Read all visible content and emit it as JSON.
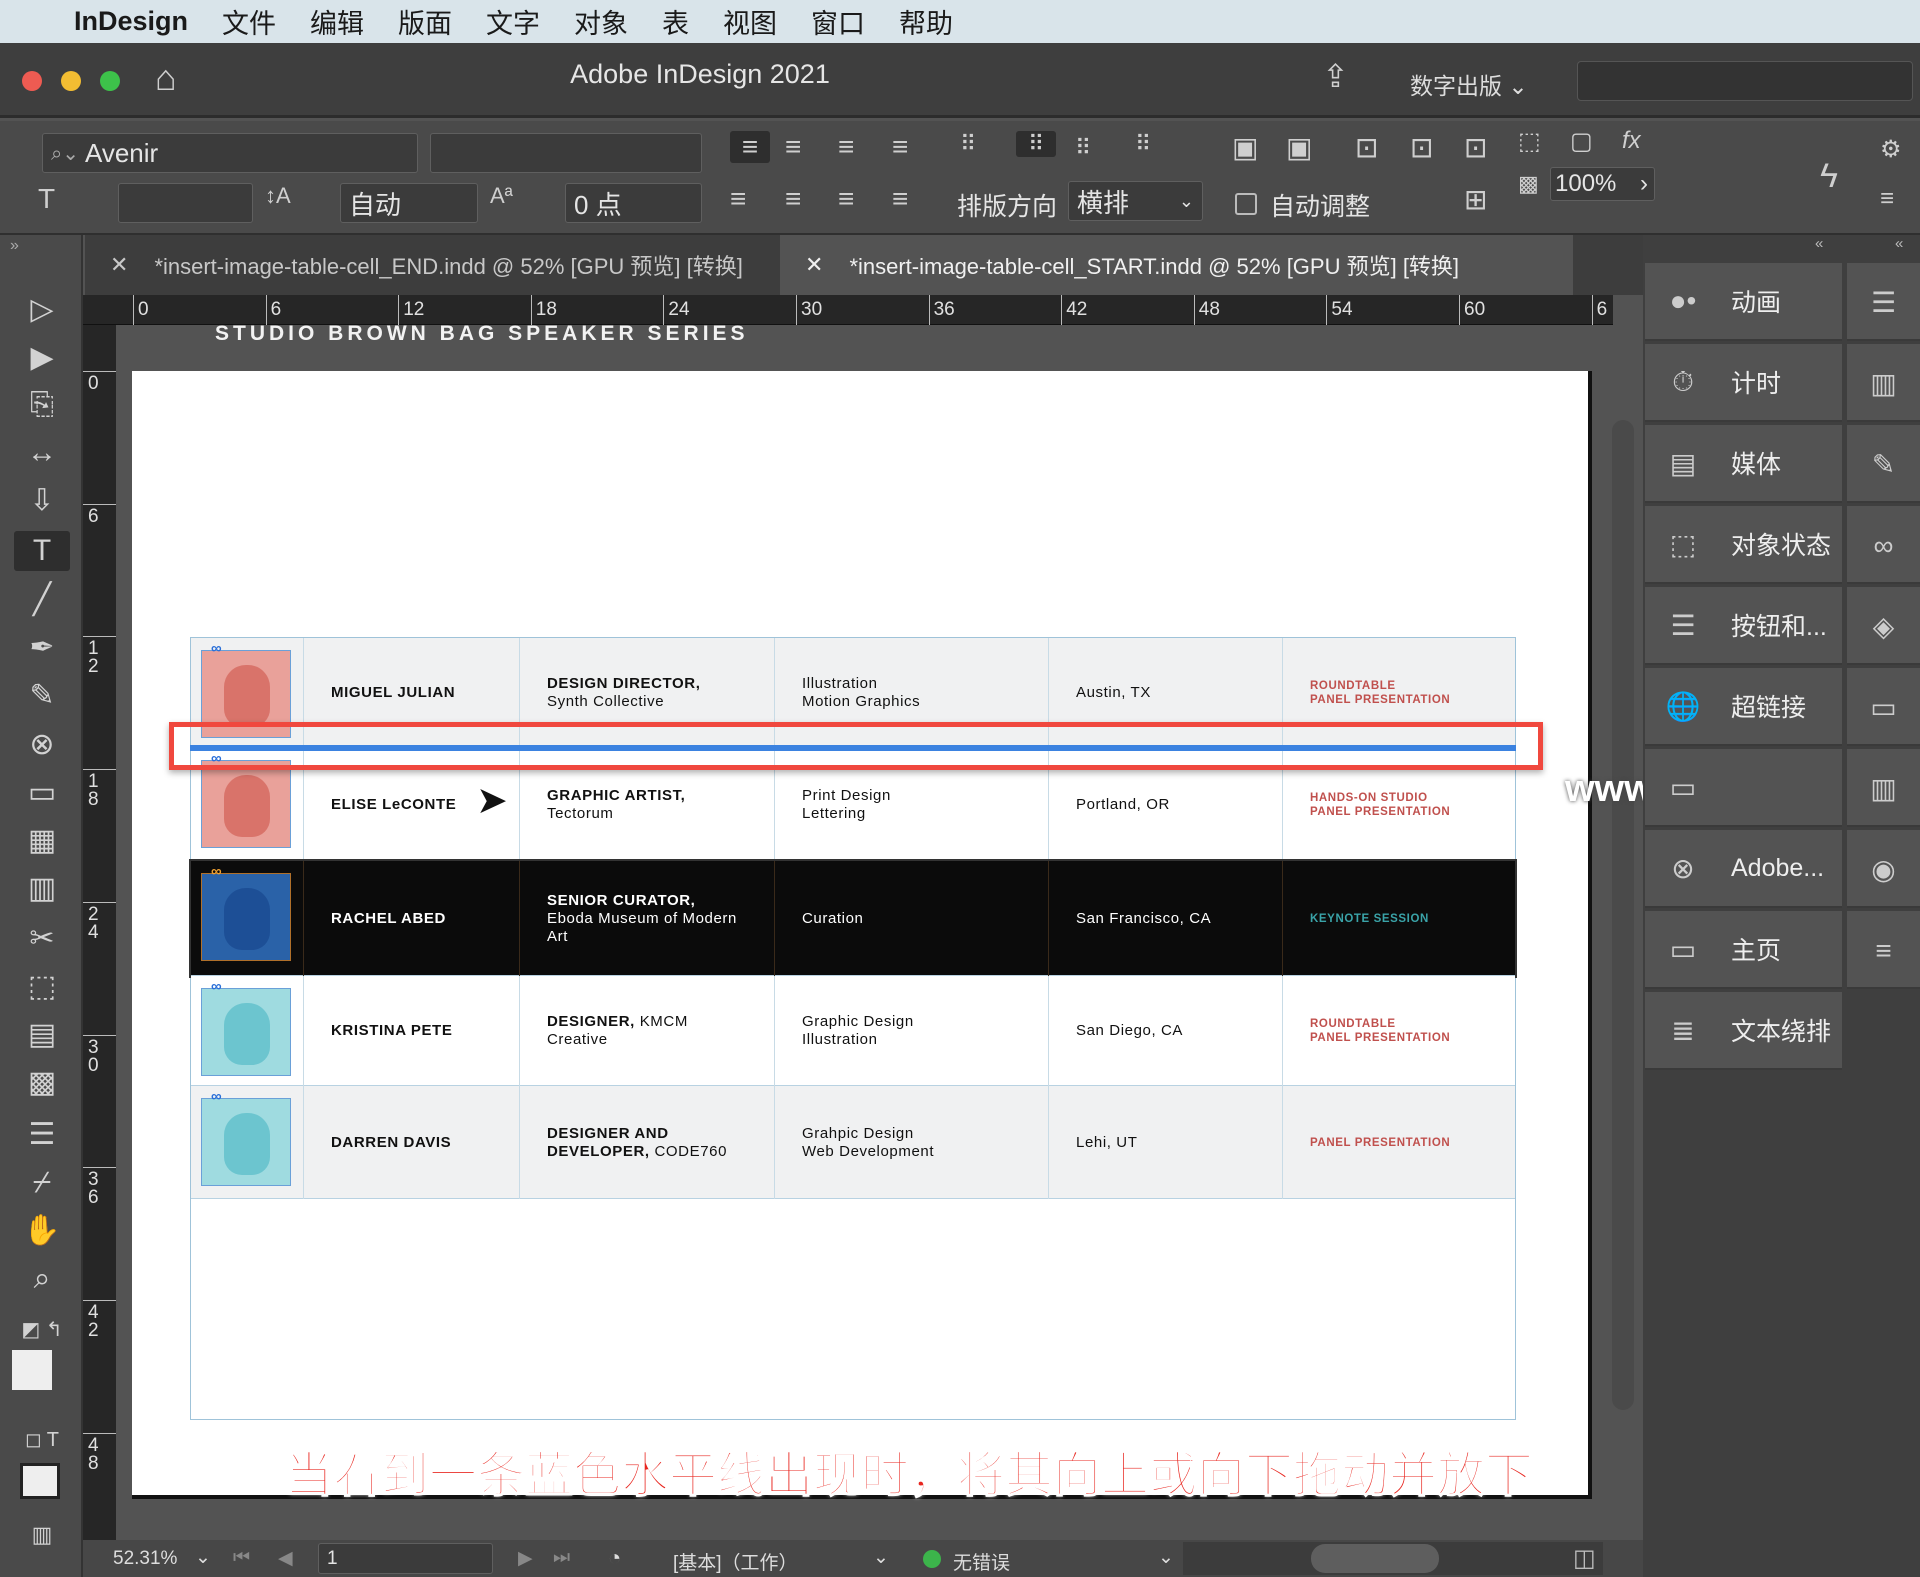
{
  "menubar": {
    "app": "InDesign",
    "items": [
      "文件",
      "编辑",
      "版面",
      "文字",
      "对象",
      "表",
      "视图",
      "窗口",
      "帮助"
    ]
  },
  "titlebar": {
    "title": "Adobe InDesign 2021",
    "workspace": "数字出版"
  },
  "control": {
    "font_family": "Avenir",
    "font_style": "",
    "font_size": "",
    "leading": "自动",
    "baseline_shift": "0 点",
    "direction_label": "排版方向",
    "direction_value": "横排",
    "autofit_label": "自动调整",
    "zoom": "100%"
  },
  "tabs": [
    {
      "label": "*insert-image-table-cell_END.indd @ 52% [GPU 预览] [转换]",
      "active": false
    },
    {
      "label": "*insert-image-table-cell_START.indd @ 52% [GPU 预览] [转换]",
      "active": true
    }
  ],
  "ruler": {
    "h": [
      "0",
      "6",
      "12",
      "18",
      "24",
      "30",
      "36",
      "42",
      "48",
      "54",
      "60",
      "6"
    ],
    "v": [
      "0",
      "6",
      "12",
      "18",
      "24",
      "30",
      "36",
      "42",
      "48"
    ]
  },
  "document": {
    "header": "STUDIO BROWN BAG SPEAKER SERIES",
    "rows": [
      {
        "name": "MIGUEL JULIAN",
        "title_bold": "DESIGN DIRECTOR,",
        "title_rest": "Synth Collective",
        "skills": [
          "Illustration",
          "Motion Graphics"
        ],
        "location": "Austin, TX",
        "tags": [
          "ROUNDTABLE",
          "PANEL PRESENTATION"
        ],
        "dark": false,
        "avatar": "#e9a19a"
      },
      {
        "name": "ELISE LeCONTE",
        "title_bold": "GRAPHIC ARTIST,",
        "title_rest": "Tectorum",
        "skills": [
          "Print Design",
          "Lettering"
        ],
        "location": "Portland, OR",
        "tags": [
          "HANDS-ON STUDIO",
          "PANEL PRESENTATION"
        ],
        "dark": false,
        "avatar": "#e9a19a"
      },
      {
        "name": "RACHEL ABED",
        "title_bold": "SENIOR CURATOR,",
        "title_rest": "Eboda Museum of Modern Art",
        "skills": [
          "Curation"
        ],
        "location": "San Francisco, CA",
        "tags": [
          "KEYNOTE SESSION"
        ],
        "dark": true,
        "avatar": "#2a62a8"
      },
      {
        "name": "KRISTINA PETE",
        "title_bold": "DESIGNER,",
        "title_rest": "KMCM Creative",
        "skills": [
          "Graphic Design",
          "Illustration"
        ],
        "location": "San Diego, CA",
        "tags": [
          "ROUNDTABLE",
          "PANEL PRESENTATION"
        ],
        "dark": false,
        "avatar": "#9fdbe0"
      },
      {
        "name": "DARREN DAVIS",
        "title_bold": "DESIGNER AND DEVELOPER,",
        "title_rest": "CODE760",
        "skills": [
          "Grahpic Design",
          "Web Development"
        ],
        "location": "Lehi, UT",
        "tags": [
          "PANEL PRESENTATION"
        ],
        "dark": false,
        "avatar": "#9fdbe0"
      }
    ]
  },
  "panels": [
    {
      "label": "动画",
      "icon": "animation-icon"
    },
    {
      "label": "计时",
      "icon": "timer-icon"
    },
    {
      "label": "媒体",
      "icon": "media-icon"
    },
    {
      "label": "对象状态",
      "icon": "object-states-icon"
    },
    {
      "label": "按钮和...",
      "icon": "buttons-icon"
    },
    {
      "label": "超链接",
      "icon": "hyperlink-icon"
    },
    {
      "label": "",
      "icon": "pages-icon"
    },
    {
      "label": "Adobe...",
      "icon": "share-icon"
    },
    {
      "label": "主页",
      "icon": "home-page-icon"
    },
    {
      "label": "文本绕排",
      "icon": "text-wrap-icon"
    }
  ],
  "watermark": "www.MacZ.com",
  "subtitle": "当看到一条蓝色水平线出现时，将其向上或向下拖动并放下",
  "status": {
    "zoom": "52.31%",
    "page": "1",
    "master": "[基本]（工作）",
    "preflight": "无错误"
  },
  "colors": {
    "guide_line": "#3b82e0",
    "highlight_box": "#f0483e",
    "tag": "#c0504d",
    "keynote": "#3aa3a8",
    "ok": "#3cb44b"
  }
}
